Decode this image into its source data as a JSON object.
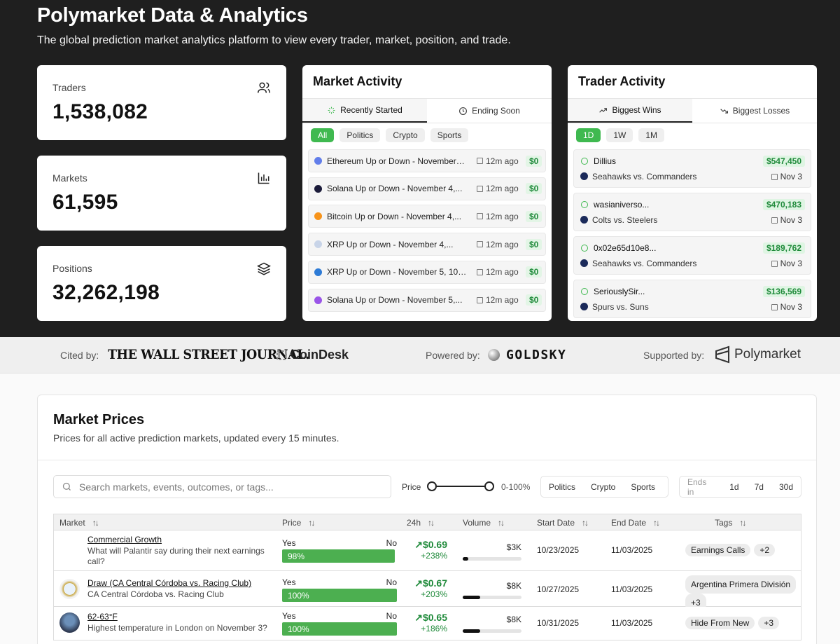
{
  "hero": {
    "title": "Polymarket Data & Analytics",
    "subtitle": "The global prediction market analytics platform to view every trader, market, position, and trade."
  },
  "stats": [
    {
      "label": "Traders",
      "value": "1,538,082",
      "icon": "users-icon"
    },
    {
      "label": "Markets",
      "value": "61,595",
      "icon": "bar-chart-icon"
    },
    {
      "label": "Positions",
      "value": "32,262,198",
      "icon": "layers-icon"
    }
  ],
  "market_activity": {
    "title": "Market Activity",
    "tabs": [
      "Recently Started",
      "Ending Soon"
    ],
    "filters": [
      "All",
      "Politics",
      "Crypto",
      "Sports"
    ],
    "rows": [
      {
        "title": "Ethereum Up or Down - November 4...",
        "ago": "12m ago",
        "amount": "$0",
        "color": "#627eea"
      },
      {
        "title": "Solana Up or Down - November 4,...",
        "ago": "12m ago",
        "amount": "$0",
        "color": "#1b1b3a"
      },
      {
        "title": "Bitcoin Up or Down - November 4,...",
        "ago": "12m ago",
        "amount": "$0",
        "color": "#f7931a"
      },
      {
        "title": "XRP Up or Down - November 4,...",
        "ago": "12m ago",
        "amount": "$0",
        "color": "#c8d4e8"
      },
      {
        "title": "XRP Up or Down - November 5, 10P...",
        "ago": "12m ago",
        "amount": "$0",
        "color": "#2e7bd6"
      },
      {
        "title": "Solana Up or Down - November 5,...",
        "ago": "12m ago",
        "amount": "$0",
        "color": "#9a55e8"
      }
    ]
  },
  "trader_activity": {
    "title": "Trader Activity",
    "tabs": [
      "Biggest Wins",
      "Biggest Losses"
    ],
    "ranges": [
      "1D",
      "1W",
      "1M"
    ],
    "rows": [
      {
        "name": "Dillius",
        "amount": "$547,450",
        "event": "Seahawks vs. Commanders",
        "date": "Nov 3"
      },
      {
        "name": "wasianiverso...",
        "amount": "$470,183",
        "event": "Colts vs. Steelers",
        "date": "Nov 3"
      },
      {
        "name": "0x02e65d10e8...",
        "amount": "$189,762",
        "event": "Seahawks vs. Commanders",
        "date": "Nov 3"
      },
      {
        "name": "SeriouslySir...",
        "amount": "$136,569",
        "event": "Spurs vs. Suns",
        "date": "Nov 3"
      }
    ]
  },
  "sponsors": {
    "cited_label": "Cited by:",
    "wsj": "THE WALL STREET JOURNAL.",
    "coindesk": "CoinDesk",
    "powered_label": "Powered by:",
    "goldsky": "GOLDSKY",
    "supported_label": "Supported by:",
    "polymarket": "Polymarket"
  },
  "prices": {
    "title": "Market Prices",
    "description": "Prices for all active prediction markets, updated every 15 minutes.",
    "search_placeholder": "Search markets, events, outcomes, or tags...",
    "price_label": "Price",
    "price_range": "0-100%",
    "categories": [
      "Politics",
      "Crypto",
      "Sports"
    ],
    "ends_label": "Ends in",
    "ends_options": [
      "1d",
      "7d",
      "30d"
    ],
    "columns": [
      "Market",
      "Price",
      "24h",
      "Volume",
      "Start Date",
      "End Date",
      "Tags"
    ],
    "rows": [
      {
        "title": "Commercial Growth",
        "sub": "What will Palantir say during their next earnings call?",
        "yes": "Yes",
        "no": "No",
        "pct": "98%",
        "pct_value": 98,
        "price": "$0.69",
        "change": "+238%",
        "volume": "$3K",
        "vol_frac": 0.1,
        "start": "10/23/2025",
        "end": "11/03/2025",
        "tags": [
          "Earnings Calls",
          "+2"
        ]
      },
      {
        "title": "Draw (CA Central Córdoba vs. Racing Club)",
        "sub": "CA Central Córdoba vs. Racing Club",
        "yes": "Yes",
        "no": "No",
        "pct": "100%",
        "pct_value": 100,
        "price": "$0.67",
        "change": "+203%",
        "volume": "$8K",
        "vol_frac": 0.3,
        "start": "10/27/2025",
        "end": "11/03/2025",
        "tags": [
          "Argentina Primera División",
          "+3"
        ]
      },
      {
        "title": "62-63°F",
        "sub": "Highest temperature in London on November 3?",
        "yes": "Yes",
        "no": "No",
        "pct": "100%",
        "pct_value": 100,
        "price": "$0.65",
        "change": "+186%",
        "volume": "$8K",
        "vol_frac": 0.3,
        "start": "10/31/2025",
        "end": "11/03/2025",
        "tags": [
          "Hide From New",
          "+3"
        ]
      }
    ]
  },
  "colors": {
    "accent_green": "#3fb950",
    "hero_bg": "#1f1f1f"
  }
}
